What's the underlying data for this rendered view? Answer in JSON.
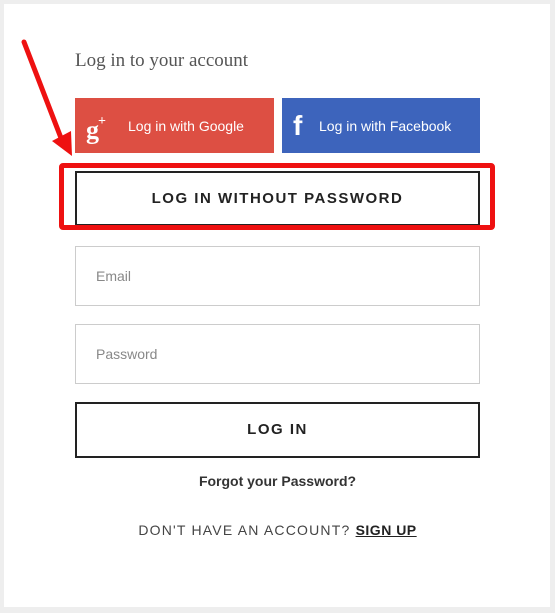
{
  "login": {
    "title": "Log in to your account",
    "google": {
      "icon": "google-plus-icon",
      "icon_text": "g",
      "icon_sup": "+",
      "label": "Log in with Google",
      "color": "#dd4f43"
    },
    "facebook": {
      "icon": "facebook-icon",
      "icon_text": "f",
      "label": "Log in with Facebook",
      "color": "#3d64bc"
    },
    "passwordless_label": "LOG IN WITHOUT PASSWORD",
    "email_placeholder": "Email",
    "email_value": "",
    "password_placeholder": "Password",
    "password_value": "",
    "submit_label": "LOG IN",
    "forgot_label": "Forgot your Password?",
    "signup_prompt": "DON'T HAVE AN ACCOUNT?",
    "signup_link": "SIGN UP"
  },
  "annotation": {
    "color": "#ee1111",
    "arrow_icon": "red-arrow-icon"
  }
}
